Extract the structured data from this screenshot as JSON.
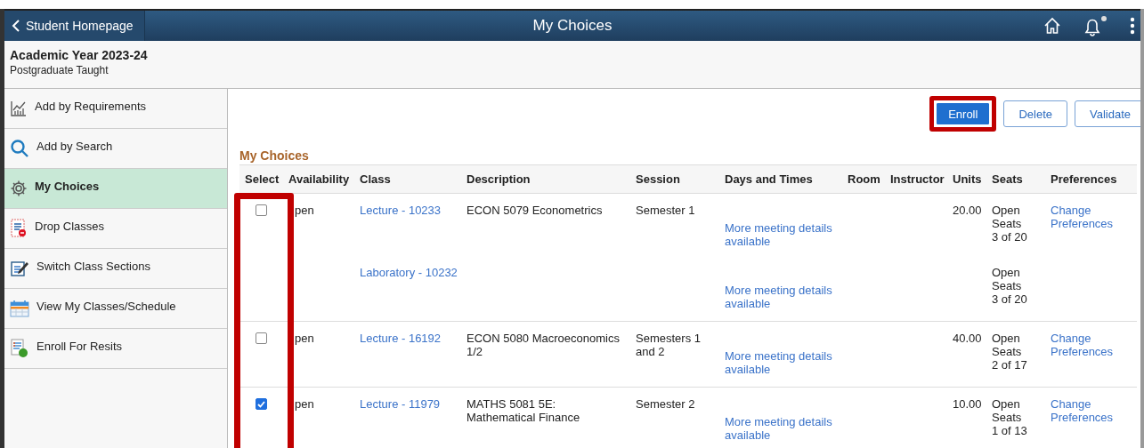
{
  "header": {
    "back_button": "Student Homepage",
    "title": "My Choices",
    "has_notification": true
  },
  "term": {
    "title": "Academic Year 2023-24",
    "career": "Postgraduate Taught"
  },
  "sidebar": {
    "items": [
      {
        "label": "Add by Requirements",
        "kind": "chart",
        "selected": false
      },
      {
        "label": "Add by Search",
        "kind": "search",
        "selected": false
      },
      {
        "label": "My Choices",
        "kind": "gear",
        "selected": true
      },
      {
        "label": "Drop Classes",
        "kind": "drop",
        "selected": false
      },
      {
        "label": "Switch Class Sections",
        "kind": "edit",
        "selected": false
      },
      {
        "label": "View My Classes/Schedule",
        "kind": "calendar",
        "selected": false
      },
      {
        "label": "Enroll For Resits",
        "kind": "resit",
        "selected": false
      }
    ]
  },
  "actions": [
    {
      "label": "Enroll",
      "kind": "primary",
      "highlighted": true
    },
    {
      "label": "Delete",
      "kind": "secondary",
      "highlighted": false
    },
    {
      "label": "Validate",
      "kind": "secondary",
      "highlighted": false
    }
  ],
  "table": {
    "title": "My Choices",
    "select_highlighted": true,
    "columns": [
      "Select",
      "Availability",
      "Class",
      "Description",
      "Session",
      "Days and Times",
      "Room",
      "Instructor",
      "Units",
      "Seats",
      "Preferences"
    ],
    "rows": [
      {
        "checked": false,
        "availability": "pen",
        "description": "ECON 5079 Econometrics",
        "session": "Semester 1",
        "units": "20.00",
        "preferences": "Change Preferences",
        "sections": [
          {
            "class": "Lecture - 10233",
            "days": "More meeting details available",
            "seats": "Open Seats 3 of 20"
          },
          {
            "class": "Laboratory - 10232",
            "days": "More meeting details available",
            "seats": "Open Seats 3 of 20"
          }
        ]
      },
      {
        "checked": false,
        "availability": "pen",
        "description": "ECON 5080 Macroeconomics 1/2",
        "session": "Semesters 1 and 2",
        "units": "40.00",
        "preferences": "Change Preferences",
        "sections": [
          {
            "class": "Lecture - 16192",
            "days": "More meeting details available",
            "seats": "Open Seats 2 of 17"
          }
        ]
      },
      {
        "checked": true,
        "availability": "pen",
        "description": "MATHS 5081 5E: Mathematical Finance",
        "session": "Semester 2",
        "units": "10.00",
        "preferences": "Change Preferences",
        "sections": [
          {
            "class": "Lecture - 11979",
            "days": "More meeting details available",
            "seats": "Open Seats 1 of 13"
          }
        ]
      }
    ]
  }
}
